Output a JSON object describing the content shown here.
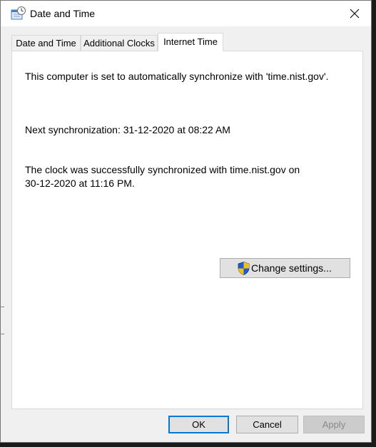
{
  "window": {
    "title": "Date and Time",
    "icon": "date-time-icon",
    "close_icon": "close-icon"
  },
  "tabs": [
    {
      "label": "Date and Time",
      "active": false
    },
    {
      "label": "Additional Clocks",
      "active": false
    },
    {
      "label": "Internet Time",
      "active": true
    }
  ],
  "internet_time": {
    "sync_status": "This computer is set to automatically synchronize with 'time.nist.gov'.",
    "next_sync": "Next synchronization: 31-12-2020 at 08:22 AM",
    "last_sync_line1": "The clock was successfully synchronized with time.nist.gov on",
    "last_sync_line2": "30-12-2020 at 11:16 PM.",
    "change_settings_label": "Change settings...",
    "shield_icon": "uac-shield-icon"
  },
  "footer": {
    "ok_label": "OK",
    "cancel_label": "Cancel",
    "apply_label": "Apply"
  },
  "colors": {
    "accent": "#0078d7",
    "shield_blue": "#1e5bd8",
    "shield_yellow": "#f4c20d"
  }
}
